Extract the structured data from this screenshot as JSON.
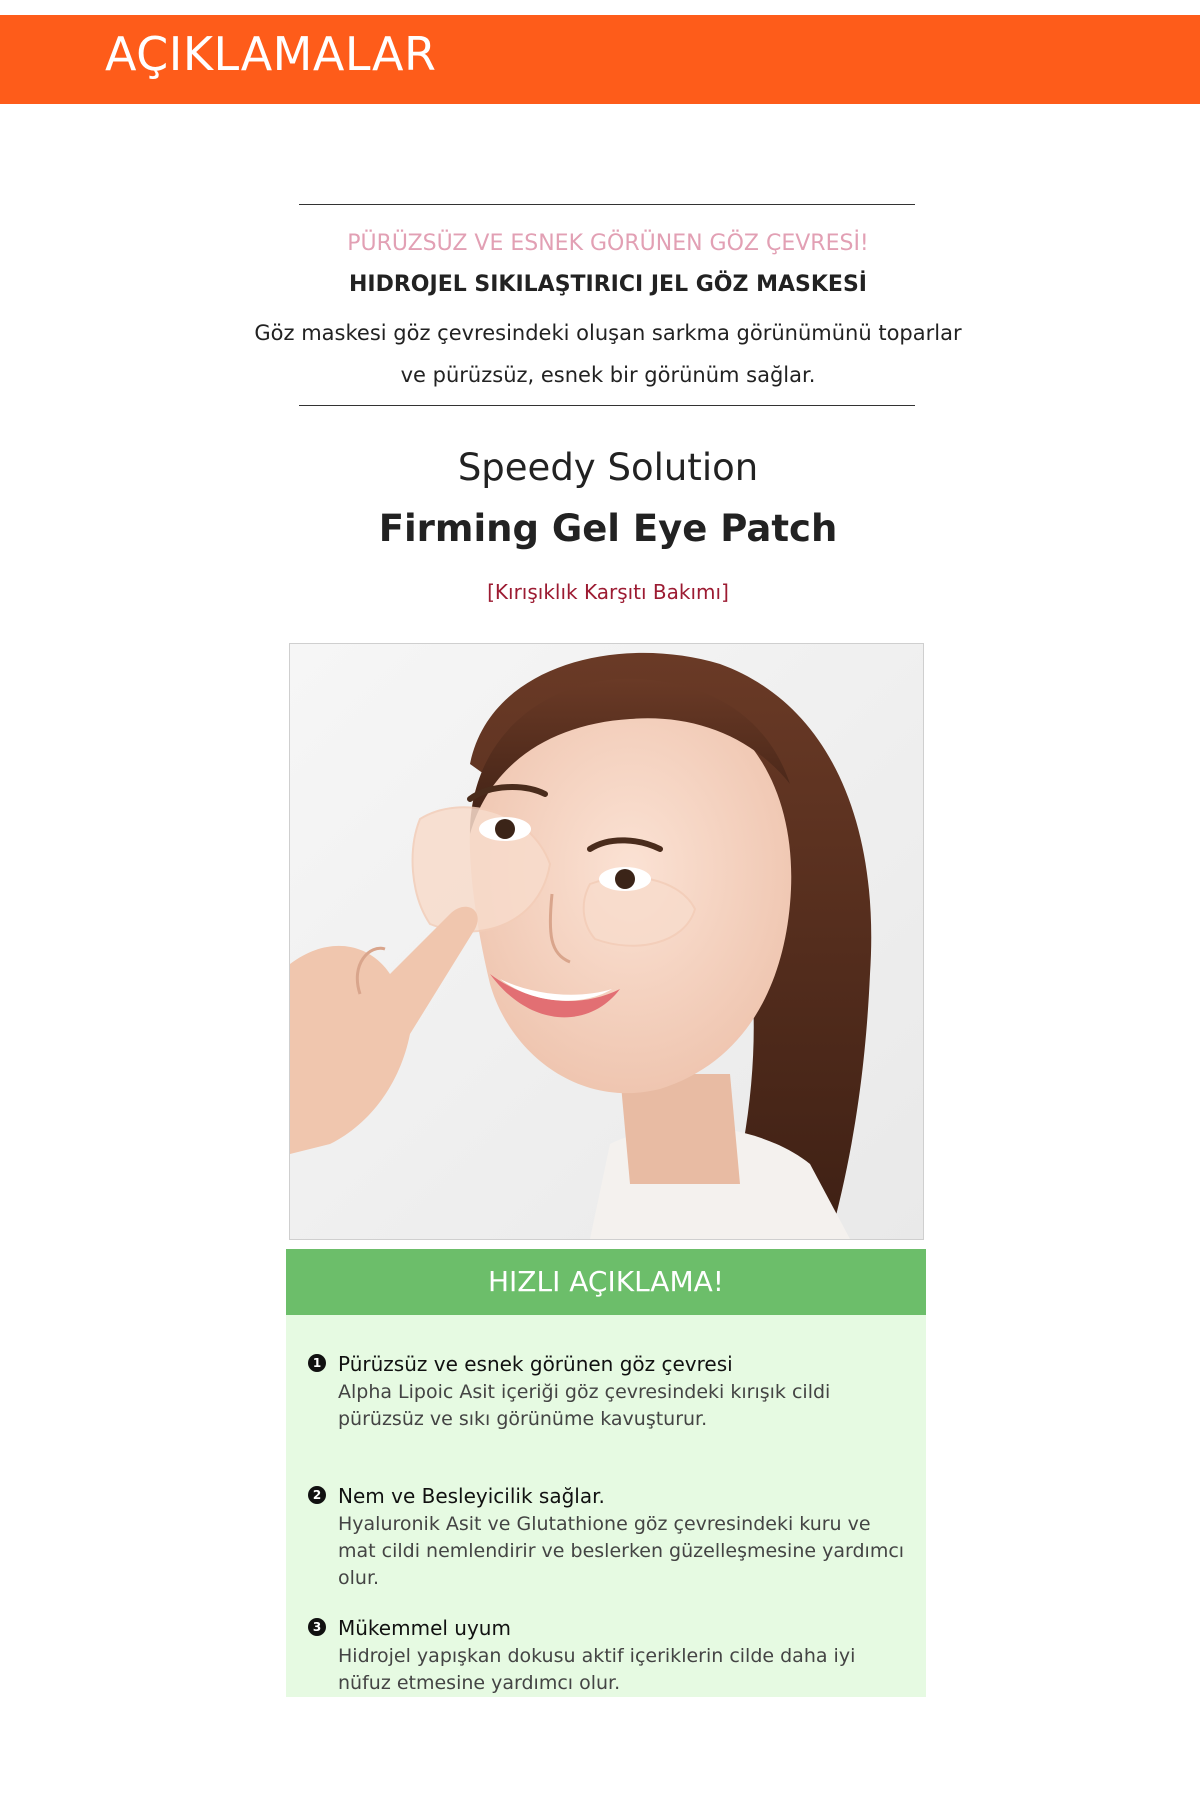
{
  "header": {
    "title": "AÇIKLAMALAR"
  },
  "intro": {
    "headline": "PÜRÜZSÜZ VE ESNEK GÖRÜNEN GÖZ ÇEVRESİ!",
    "subheadline": "HIDROJEL SIKILAŞTIRICI JEL GÖZ MASKESİ",
    "body_line1": "Göz maskesi göz çevresindeki oluşan sarkma görünümünü toparlar",
    "body_line2": "ve pürüzsüz, esnek bir görünüm sağlar."
  },
  "product": {
    "series": "Speedy Solution",
    "name": "Firming Gel Eye Patch",
    "tag": "[Kırışıklık Karşıtı Bakımı]"
  },
  "colors": {
    "header_orange": "#fe5c1a",
    "accent_pink": "#e2a0b4",
    "tag_red": "#9c1b32",
    "quick_green": "#6cbe6a",
    "quick_bg": "#e6fae2"
  },
  "quick": {
    "title": "HIZLI AÇIKLAMA!",
    "features": [
      {
        "number": "1",
        "title": "Pürüzsüz ve esnek görünen göz çevresi",
        "desc_line1": "Alpha Lipoic Asit içeriği göz çevresindeki kırışık cildi",
        "desc_line2": "pürüzsüz ve sıkı görünüme kavuşturur."
      },
      {
        "number": "2",
        "title": "Nem ve Besleyicilik sağlar.",
        "desc_line1": "Hyaluronik Asit ve Glutathione göz çevresindeki kuru ve",
        "desc_line2": "mat cildi nemlendirir ve beslerken güzelleşmesine yardımcı olur."
      },
      {
        "number": "3",
        "title": "Mükemmel uyum",
        "desc_line1": "Hidrojel yapışkan dokusu aktif içeriklerin cilde daha iyi",
        "desc_line2": "nüfuz etmesine yardımcı olur."
      }
    ]
  }
}
